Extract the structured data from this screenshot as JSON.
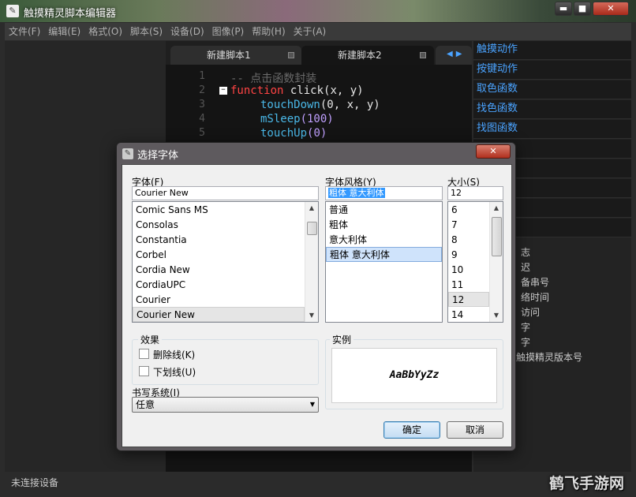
{
  "window": {
    "title": "触摸精灵脚本编辑器",
    "min": "▬",
    "max": "■",
    "close": "✕"
  },
  "menu": [
    "文件(F)",
    "编辑(E)",
    "格式(O)",
    "脚本(S)",
    "设备(D)",
    "图像(P)",
    "帮助(H)",
    "关于(A)"
  ],
  "tabs": [
    {
      "label": "新建脚本1"
    },
    {
      "label": "新建脚本2"
    }
  ],
  "editor": {
    "lines": [
      {
        "n": "1",
        "text": "-- 点击函数封装"
      },
      {
        "n": "2",
        "kw": "function",
        "rest": " click(x, y)"
      },
      {
        "n": "3",
        "call": "touchDown",
        "args": "(0, x, y)"
      },
      {
        "n": "4",
        "call": "mSleep",
        "args": "(100)"
      },
      {
        "n": "5",
        "call": "touchUp",
        "args": "(0)"
      }
    ]
  },
  "right_panel": {
    "items": [
      "触摸动作",
      "按键动作",
      "取色函数",
      "找色函数",
      "找图函数"
    ],
    "sub_items": [
      "志",
      "迟",
      "备串号",
      "络时间",
      "访问",
      "字",
      "字",
      "触摸精灵版本号"
    ]
  },
  "status": {
    "text": "未连接设备"
  },
  "watermark": "鹤飞手游网",
  "dialog": {
    "title": "选择字体",
    "font_label": "字体(F)",
    "font_value": "Courier New",
    "fonts": [
      "Comic Sans MS",
      "Consolas",
      "Constantia",
      "Corbel",
      "Cordia New",
      "CordiaUPC",
      "Courier",
      "Courier New"
    ],
    "style_label": "字体风格(Y)",
    "style_value": "粗体 意大利体",
    "styles": [
      "普通",
      "粗体",
      "意大利体",
      "粗体 意大利体"
    ],
    "size_label": "大小(S)",
    "size_value": "12",
    "sizes": [
      "6",
      "7",
      "8",
      "9",
      "10",
      "11",
      "12",
      "14"
    ],
    "effects_label": "效果",
    "strikeout_label": "删除线(K)",
    "underline_label": "下划线(U)",
    "sample_label": "实例",
    "sample_text": "AaBbYyZz",
    "script_label": "书写系统(I)",
    "script_value": "任意",
    "ok_label": "确定",
    "cancel_label": "取消"
  }
}
